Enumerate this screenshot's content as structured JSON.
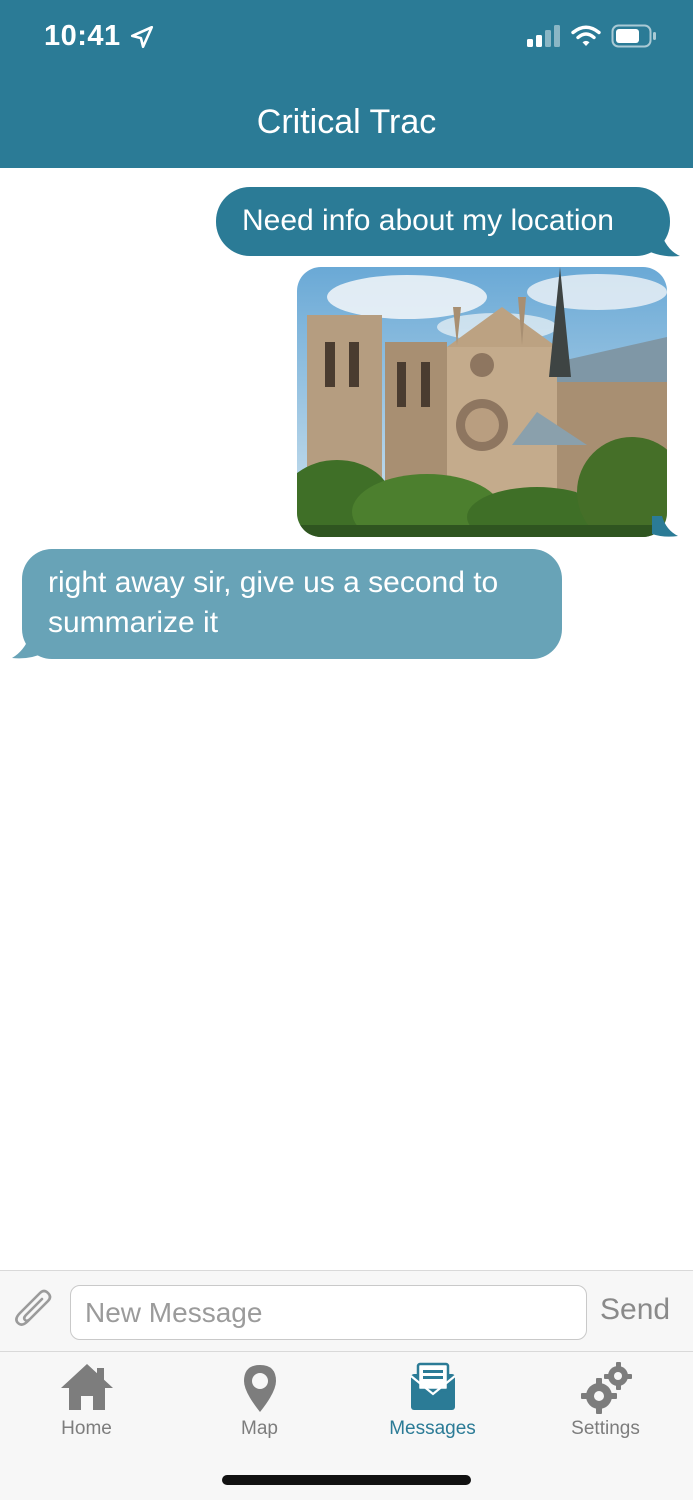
{
  "status_bar": {
    "time": "10:41",
    "icons": [
      "location-arrow-icon",
      "cellular-signal-icon",
      "wifi-icon",
      "battery-icon"
    ]
  },
  "header": {
    "title": "Critical Trac"
  },
  "messages": [
    {
      "direction": "outgoing",
      "type": "text",
      "text": "Need info about my location"
    },
    {
      "direction": "outgoing",
      "type": "image",
      "image": "cathedral-photo"
    },
    {
      "direction": "incoming",
      "type": "text",
      "text": "right away sir, give us a second to summarize it"
    }
  ],
  "composer": {
    "attach_icon": "paperclip-icon",
    "placeholder": "New Message",
    "value": "",
    "send_label": "Send"
  },
  "tabbar": {
    "tabs": [
      {
        "label": "Home",
        "icon": "home-icon",
        "active": false
      },
      {
        "label": "Map",
        "icon": "map-pin-icon",
        "active": false
      },
      {
        "label": "Messages",
        "icon": "messages-icon",
        "active": true
      },
      {
        "label": "Settings",
        "icon": "settings-gears-icon",
        "active": false
      }
    ]
  },
  "colors": {
    "brand": "#2b7b96",
    "incoming_bubble": "#68a3b7",
    "tab_inactive": "#7d7d7d"
  }
}
